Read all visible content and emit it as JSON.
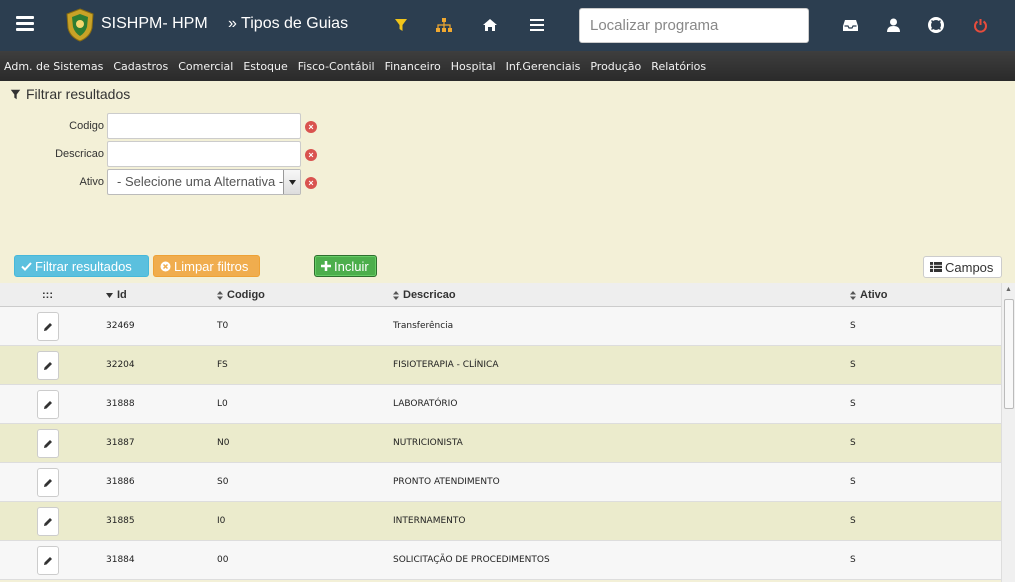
{
  "app": {
    "title": "SISHPM- HPM",
    "page_title": "» Tipos de Guias"
  },
  "search": {
    "placeholder": "Localizar programa"
  },
  "menu": [
    "Adm. de Sistemas",
    "Cadastros",
    "Comercial",
    "Estoque",
    "Fisco-Contábil",
    "Financeiro",
    "Hospital",
    "Inf.Gerenciais",
    "Produção",
    "Relatórios"
  ],
  "filter": {
    "header": "Filtrar resultados",
    "codigo_label": "Codigo",
    "descricao_label": "Descricao",
    "ativo_label": "Ativo",
    "ativo_selected": "- Selecione uma Alternativa -"
  },
  "buttons": {
    "filtrar": "Filtrar resultados",
    "limpar": "Limpar filtros",
    "incluir": "Incluir",
    "campos": "Campos"
  },
  "table": {
    "columns": {
      "handle": ":::",
      "id": "Id",
      "codigo": "Codigo",
      "descricao": "Descricao",
      "ativo": "Ativo"
    },
    "rows": [
      {
        "id": "32469",
        "codigo": "T0",
        "descricao": "Transferência",
        "ativo": "S"
      },
      {
        "id": "32204",
        "codigo": "FS",
        "descricao": "FISIOTERAPIA - CLÍNICA",
        "ativo": "S"
      },
      {
        "id": "31888",
        "codigo": "L0",
        "descricao": "LABORATÓRIO",
        "ativo": "S"
      },
      {
        "id": "31887",
        "codigo": "N0",
        "descricao": "NUTRICIONISTA",
        "ativo": "S"
      },
      {
        "id": "31886",
        "codigo": "S0",
        "descricao": "PRONTO ATENDIMENTO",
        "ativo": "S"
      },
      {
        "id": "31885",
        "codigo": "I0",
        "descricao": "INTERNAMENTO",
        "ativo": "S"
      },
      {
        "id": "31884",
        "codigo": "00",
        "descricao": "SOLICITAÇÃO DE PROCEDIMENTOS",
        "ativo": "S"
      }
    ]
  },
  "icons": {
    "menu": "hamburger-icon",
    "filter": "filter-icon",
    "sitemap": "sitemap-icon",
    "home": "home-icon",
    "list": "list-icon",
    "inbox": "inbox-icon",
    "user": "user-icon",
    "help": "lifebuoy-icon",
    "power": "power-icon"
  },
  "colors": {
    "topbar": "#2c3e50",
    "filter_icon": "#f0c419",
    "sitemap_icon": "#f0a830",
    "power_icon": "#e74c3c",
    "even_row": "#ebebcc"
  }
}
